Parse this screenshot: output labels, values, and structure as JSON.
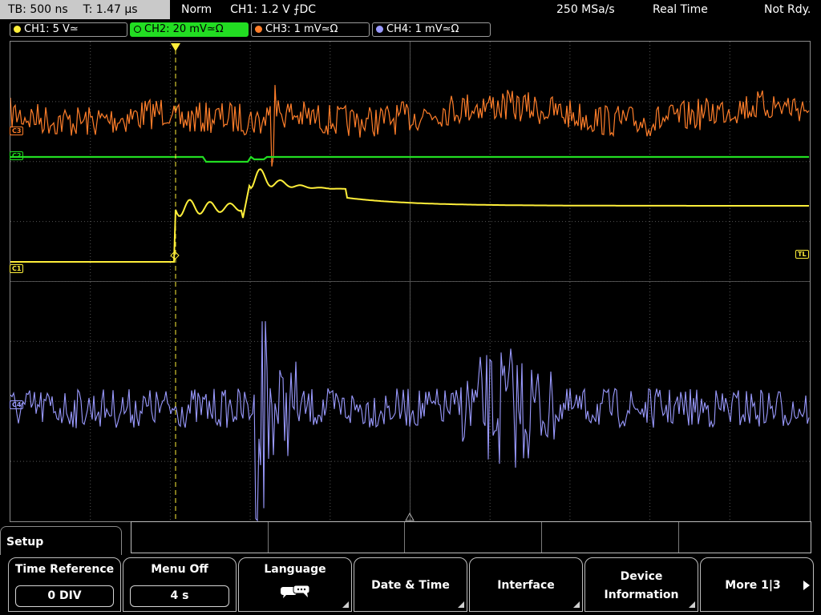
{
  "status": {
    "timebase": "TB: 500 ns",
    "trigger_time": "T: 1.47 µs",
    "mode": "Norm",
    "trigger_setting": "CH1: 1.2 V ⨍DC",
    "sample_rate": "250 MSa/s",
    "acq_mode": "Real Time",
    "state": "Not Rdy."
  },
  "channels": [
    {
      "label": "CH1: 5 V≃",
      "color": "#ffef3a"
    },
    {
      "label": "CH2: 20 mV≃Ω",
      "color": "#22dd22"
    },
    {
      "label": "CH3: 1 mV≃Ω",
      "color": "#ff7e2a"
    },
    {
      "label": "CH4: 1 mV≃Ω",
      "color": "#9a9aff"
    }
  ],
  "markers": {
    "c1": "C1",
    "c2": "C2",
    "c3": "C3",
    "c4": "C4",
    "trigger_level": "TL"
  },
  "menu": {
    "setup_label": "Setup",
    "softkeys": [
      {
        "label": "Time Reference",
        "value": "0 DIV"
      },
      {
        "label": "Menu Off",
        "value": "4 s"
      },
      {
        "label": "Language",
        "icon": "speech-bubbles-icon"
      },
      {
        "label": "Date & Time"
      },
      {
        "label": "Interface"
      },
      {
        "label_line1": "Device",
        "label_line2": "Information"
      },
      {
        "label": "More 1|3",
        "icon": "arrow-right-icon"
      }
    ]
  },
  "colors": {
    "ch1": "#ffef3a",
    "ch2": "#22dd22",
    "ch3": "#ff7e2a",
    "ch4": "#9a9aff",
    "grid": "#555555"
  }
}
